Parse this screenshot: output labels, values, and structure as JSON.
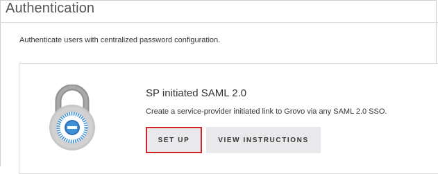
{
  "header": {
    "title": "Authentication"
  },
  "main": {
    "description": "Authenticate users with centralized password configuration."
  },
  "card": {
    "icon": "padlock-icon",
    "title": "SP initiated SAML 2.0",
    "description": "Create a service-provider initiated link to Grovo via any SAML 2.0 SSO.",
    "setup_label": "SET UP",
    "view_label": "VIEW INSTRUCTIONS",
    "highlight_color": "#d0232a",
    "lock_accent_color": "#3d8fd6"
  }
}
